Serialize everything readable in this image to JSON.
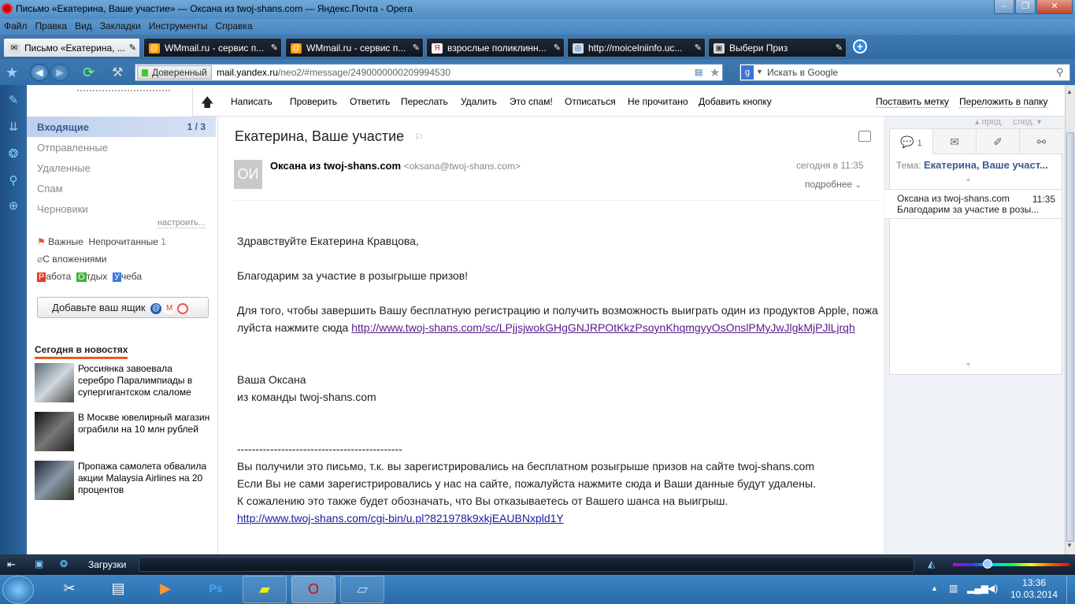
{
  "window": {
    "title": "Письмо «Екатерина, Ваше участие» — Оксана из twoj-shans.com — Яндекс.Почта - Opera"
  },
  "menu": [
    "Файл",
    "Правка",
    "Вид",
    "Закладки",
    "Инструменты",
    "Справка"
  ],
  "tabs": [
    {
      "label": "Письмо «Екатерина, ...",
      "active": true
    },
    {
      "label": "WMmail.ru - сервис п...",
      "active": false
    },
    {
      "label": "WMmail.ru - сервис п...",
      "active": false
    },
    {
      "label": "взрослые поликлинн...",
      "active": false
    },
    {
      "label": "http://moicelniinfo.uc...",
      "active": false
    },
    {
      "label": "Выбери Приз",
      "active": false
    }
  ],
  "address": {
    "secure_label": "Доверенный",
    "domain": "mail.yandex.ru",
    "path": "/neo2/#message/2490000000209994530"
  },
  "search": {
    "placeholder": "Искать в Google"
  },
  "toolbar": {
    "items": [
      "Написать",
      "Проверить",
      "Ответить",
      "Переслать",
      "Удалить",
      "Это спам!",
      "Отписаться",
      "Не прочитано",
      "Добавить кнопку"
    ],
    "right": [
      "Поставить метку",
      "Переложить в папку"
    ]
  },
  "folders": [
    {
      "label": "Входящие",
      "count": "1 / 3",
      "active": true
    },
    {
      "label": "Отправленные"
    },
    {
      "label": "Удаленные"
    },
    {
      "label": "Спам"
    },
    {
      "label": "Черновики"
    }
  ],
  "configure": "настроить...",
  "filters": {
    "important": "Важные",
    "unread": "Непрочитанные",
    "unread_count": "1",
    "attachments": "С вложениями"
  },
  "labels": [
    {
      "letter": "Р",
      "rest": "абота",
      "color": "#e53a2a"
    },
    {
      "letter": "О",
      "rest": "тдых",
      "color": "#3bb33b"
    },
    {
      "letter": "У",
      "rest": "чеба",
      "color": "#3a7be0"
    }
  ],
  "add_mailbox": "Добавьте ваш ящик",
  "news": {
    "heading": "Сегодня в новостях",
    "items": [
      "Россиянка завоевала серебро Паралимпиады в супергигантском слаломе",
      "В Москве ювелирный магазин ограбили на 10 млн рублей",
      "Пропажа самолета обвалила акции Malaysia Airlines на 20 процентов"
    ]
  },
  "message": {
    "subject": "Екатерина, Ваше участие",
    "avatar": "ОИ",
    "sender_name": "Оксана из twoj-shans.com",
    "sender_email": "<oksana@twoj-shans.com>",
    "time": "сегодня в 11:35",
    "details": "подробнее",
    "greeting": "Здравствуйте Екатерина Кравцова,",
    "thanks": "Благодарим за участие в розыгрыше призов!",
    "line1": "Для того, чтобы завершить Вашу бесплатную регистрацию и получить возможность выиграть один из продуктов Apple, пожалуйста нажмите сюда",
    "link1": "http://www.twoj-shans.com/sc/LPjjsjwokGHgGNJRPOtKkzPsoynKhqmgyyOsOnslPMyJwJlgkMjPJlLjrqh",
    "sign1": "Ваша Оксана",
    "sign2": "из команды twoj-shans.com",
    "divider": "---------------------------------------------",
    "footer1": "Вы получили это письмо, т.к. вы зарегистрировались на бесплатном розыгрыше призов на сайте twoj-shans.com",
    "footer2": "Если Вы не сами зарегистрировались у нас на сайте, пожалуйста нажмите сюда и Ваши данные будут удалены.",
    "footer3": "К сожалению это также  будет обозначать, что Вы отказываетесь от Вашего шанса на выигрыш.",
    "link2": "http://www.twoj-shans.com/cgi-bin/u.pl?821978k9xkjEAUBNxpld1Y"
  },
  "pagenav": {
    "prev": "пред.",
    "next": "след."
  },
  "thread": {
    "count": "1",
    "subject_label": "Тема:",
    "subject": "Екатерина, Ваше участ...",
    "item_sender": "Оксана из twoj-shans.com",
    "item_time": "11:35",
    "item_preview": "Благодарим за участие в розы..."
  },
  "statusbar": {
    "downloads": "Загрузки"
  },
  "clock": {
    "time": "13:36",
    "date": "10.03.2014"
  }
}
